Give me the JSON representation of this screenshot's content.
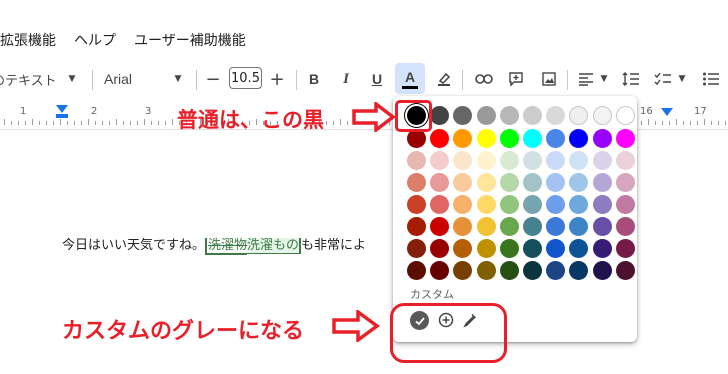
{
  "menu": {
    "items": [
      "拡張機能",
      "ヘルプ",
      "ユーザー補助機能"
    ]
  },
  "toolbar": {
    "style_value": "通常のテキスト",
    "font_value": "Arial",
    "font_size_value": "10.5",
    "minus": "−",
    "plus": "+",
    "bold": "B",
    "italic": "I",
    "underline": "U",
    "text_color": "A"
  },
  "ruler": {
    "labels": [
      "1",
      "2",
      "3",
      "16",
      "17"
    ]
  },
  "document": {
    "text_before": "今日はいい天気ですね。",
    "deleted_word": "洗濯物",
    "inserted_word": "洗濯もの",
    "text_after": "も非常によ"
  },
  "palette": {
    "custom_label": "カスタム",
    "rows": [
      [
        "#000000",
        "#434343",
        "#666666",
        "#999999",
        "#b7b7b7",
        "#cccccc",
        "#d9d9d9",
        "#efefef",
        "#f3f3f3",
        "#ffffff"
      ],
      [
        "#980000",
        "#ff0000",
        "#ff9900",
        "#ffff00",
        "#00ff00",
        "#00ffff",
        "#4a86e8",
        "#0000ff",
        "#9900ff",
        "#ff00ff"
      ],
      [
        "#e6b8af",
        "#f4cccc",
        "#fce5cd",
        "#fff2cc",
        "#d9ead3",
        "#d0e0e3",
        "#c9daf8",
        "#cfe2f3",
        "#d9d2e9",
        "#ead1dc"
      ],
      [
        "#dd7e6b",
        "#ea9999",
        "#f9cb9c",
        "#ffe599",
        "#b6d7a8",
        "#a2c4c9",
        "#a4c2f4",
        "#9fc5e8",
        "#b4a7d6",
        "#d5a6bd"
      ],
      [
        "#cc4125",
        "#e06666",
        "#f6b26b",
        "#ffd966",
        "#93c47d",
        "#76a5af",
        "#6d9eeb",
        "#6fa8dc",
        "#8e7cc3",
        "#c27ba0"
      ],
      [
        "#a61c00",
        "#cc0000",
        "#e69138",
        "#f1c232",
        "#6aa84f",
        "#45818e",
        "#3c78d8",
        "#3d85c6",
        "#674ea7",
        "#a64d79"
      ],
      [
        "#85200c",
        "#990000",
        "#b45f06",
        "#bf9000",
        "#38761d",
        "#134f5c",
        "#1155cc",
        "#0b5394",
        "#351c75",
        "#741b47"
      ],
      [
        "#5b0f00",
        "#660000",
        "#783f04",
        "#7f6000",
        "#274e13",
        "#0c343d",
        "#1c4587",
        "#073763",
        "#20124d",
        "#4c1130"
      ]
    ],
    "custom_colors": [
      "#595959"
    ]
  },
  "annotations": {
    "top": "普通は、この黒",
    "bottom": "カスタムのグレーになる",
    "color": "#e8202a"
  }
}
